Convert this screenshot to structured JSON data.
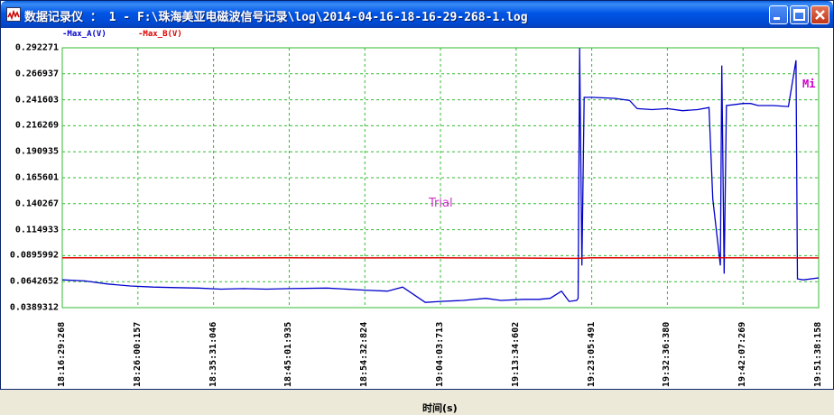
{
  "window": {
    "title": "数据记录仪 ： 1 - F:\\珠海美亚电磁波信号记录\\log\\2014-04-16-18-16-29-268-1.log",
    "buttons": [
      "minimize",
      "maximize",
      "close"
    ]
  },
  "legend": {
    "series_a_label": "-Max_A(V)",
    "series_b_label": "-Max_B(V)"
  },
  "overlay": {
    "mi_label": "Mi",
    "watermark": "Trial"
  },
  "colors": {
    "series_a": "#0000cc",
    "series_b": "#dd0000",
    "grid": "#33bb33",
    "title_bar": "#0055e5"
  },
  "chart_data": {
    "type": "line",
    "xlabel": "时间(s)",
    "ylabel": "",
    "ylim": [
      0.0389312,
      0.292271
    ],
    "y_ticks": [
      "0.292271",
      "0.266937",
      "0.241603",
      "0.216269",
      "0.190935",
      "0.165601",
      "0.140267",
      "0.114933",
      "0.0895992",
      "0.0642652",
      "0.0389312"
    ],
    "x_ticks": [
      "18:16:29:268",
      "18:26:00:157",
      "18:35:31:046",
      "18:45:01:935",
      "18:54:32:824",
      "19:04:03:713",
      "19:13:34:602",
      "19:23:05:491",
      "19:32:36:380",
      "19:42:07:269",
      "19:51:38:158"
    ],
    "grid": true,
    "series": [
      {
        "name": "Max_A(V)",
        "x": [
          0,
          0.3,
          0.6,
          0.9,
          1.2,
          1.5,
          1.8,
          2.1,
          2.4,
          2.7,
          3.0,
          3.5,
          4.0,
          4.3,
          4.5,
          4.8,
          5.0,
          5.3,
          5.6,
          5.8,
          6.1,
          6.3,
          6.45,
          6.6,
          6.7,
          6.8,
          6.82,
          6.84,
          6.87,
          6.9,
          7.0,
          7.3,
          7.5,
          7.6,
          7.8,
          8.0,
          8.2,
          8.4,
          8.55,
          8.6,
          8.7,
          8.72,
          8.75,
          8.78,
          8.9,
          9.0,
          9.1,
          9.2,
          9.4,
          9.6,
          9.7,
          9.72,
          9.8,
          10.0
        ],
        "values": [
          0.066,
          0.065,
          0.062,
          0.06,
          0.059,
          0.0585,
          0.058,
          0.057,
          0.0575,
          0.057,
          0.0575,
          0.058,
          0.056,
          0.055,
          0.059,
          0.044,
          0.045,
          0.046,
          0.048,
          0.046,
          0.047,
          0.047,
          0.048,
          0.055,
          0.045,
          0.046,
          0.048,
          0.292,
          0.08,
          0.244,
          0.244,
          0.243,
          0.241,
          0.233,
          0.232,
          0.233,
          0.231,
          0.232,
          0.234,
          0.145,
          0.08,
          0.275,
          0.072,
          0.236,
          0.237,
          0.238,
          0.238,
          0.236,
          0.236,
          0.235,
          0.28,
          0.067,
          0.066,
          0.068
        ]
      },
      {
        "name": "Max_B(V)",
        "x": [
          0,
          1,
          2,
          3,
          4,
          5,
          6,
          6.8,
          7,
          8,
          9,
          10
        ],
        "values": [
          0.0875,
          0.0876,
          0.0874,
          0.0875,
          0.0874,
          0.0875,
          0.0873,
          0.087,
          0.0875,
          0.0876,
          0.0875,
          0.0874
        ]
      }
    ]
  }
}
